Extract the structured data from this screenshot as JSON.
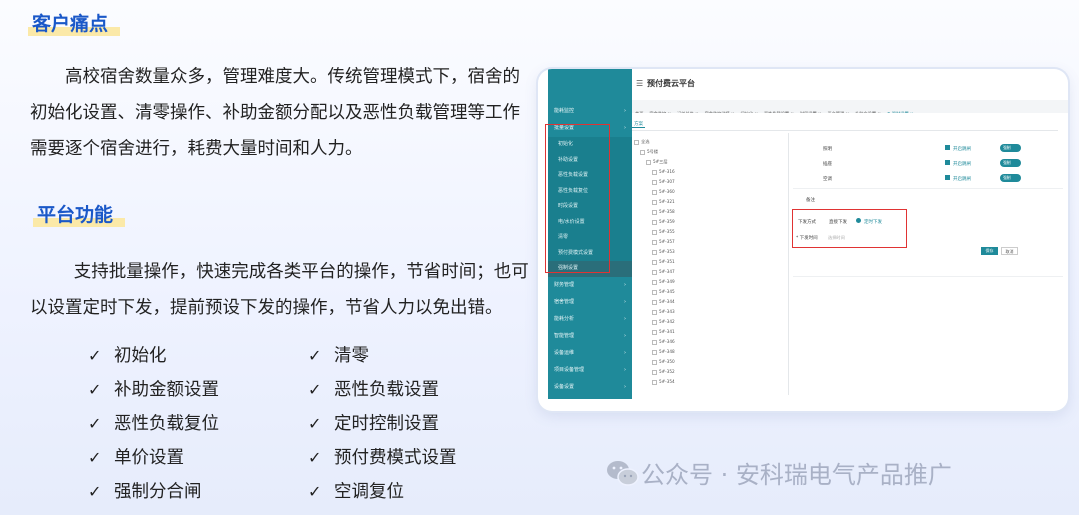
{
  "section1": {
    "heading": "客户痛点",
    "text": "高校宿舍数量众多，管理难度大。传统管理模式下，宿舍的初始化设置、清零操作、补助金额分配以及恶性负载管理等工作需要逐个宿舍进行，耗费大量时间和人力。"
  },
  "section2": {
    "heading": "平台功能",
    "text": "支持批量操作，快速完成各类平台的操作，节省时间；也可以设置定时下发，提前预设下发的操作，节省人力以免出错。"
  },
  "features": [
    "初始化",
    "清零",
    "补助金额设置",
    "恶性负载设置",
    "恶性负载复位",
    "定时控制设置",
    "单价设置",
    "预付费模式设置",
    "强制分合闸",
    "空调复位"
  ],
  "check_glyph": "✓",
  "screenshot": {
    "app_title": "预付费云平台",
    "menu_icon": "hamburger-icon",
    "tabs": [
      "首页",
      "宿舍监控 ×",
      "订单总览 ×",
      "宿舍监控详情 ×",
      "初始化 ×",
      "恶性负载设置 ×",
      "时段设置 ×",
      "平台管理 ×",
      "补助金设置 ×",
      "● 强制设置 ×"
    ],
    "subtab": "方案",
    "sidebar": {
      "top_items": [
        "能耗监控",
        "批量设置"
      ],
      "sub_items": [
        "初始化",
        "补助设置",
        "恶性负载设置",
        "恶性负载复位",
        "时段设置",
        "电/水价设置",
        "清零",
        "预付费模式设置",
        "强制设置"
      ],
      "bottom_items": [
        "财务管理",
        "宿舍管理",
        "能耗分析",
        "智能管理",
        "设备运维",
        "项目设备管理",
        "设备设置"
      ]
    },
    "tree": [
      "全选",
      "5号楼",
      "5#三层",
      "5#-316",
      "5#-307",
      "5#-360",
      "5#-321",
      "5#-358",
      "5#-359",
      "5#-355",
      "5#-357",
      "5#-353",
      "5#-351",
      "5#-347",
      "5#-349",
      "5#-345",
      "5#-344",
      "5#-343",
      "5#-342",
      "5#-341",
      "5#-346",
      "5#-348",
      "5#-350",
      "5#-352",
      "5#-354"
    ],
    "form": {
      "rows": [
        {
          "label": "照明",
          "check": "开启跳闸",
          "toggle": "强制"
        },
        {
          "label": "插座",
          "check": "开启跳闸",
          "toggle": "强制"
        },
        {
          "label": "空调",
          "check": "开启跳闸",
          "toggle": "强制"
        }
      ],
      "remark_label": "备注",
      "issue_mode_label": "下发方式",
      "issue_direct": "直接下发",
      "issue_timed": "定时下发",
      "issue_time_label": "* 下发时间",
      "issue_time_placeholder": "选择时间",
      "save": "保存",
      "cancel": "取消"
    }
  },
  "watermark": "公众号 · 安科瑞电气产品推广",
  "colors": {
    "accent": "#1a58c8",
    "highlight": "#fbe9a8",
    "sidebar": "#1f8a9a",
    "red_box": "#e03333"
  }
}
